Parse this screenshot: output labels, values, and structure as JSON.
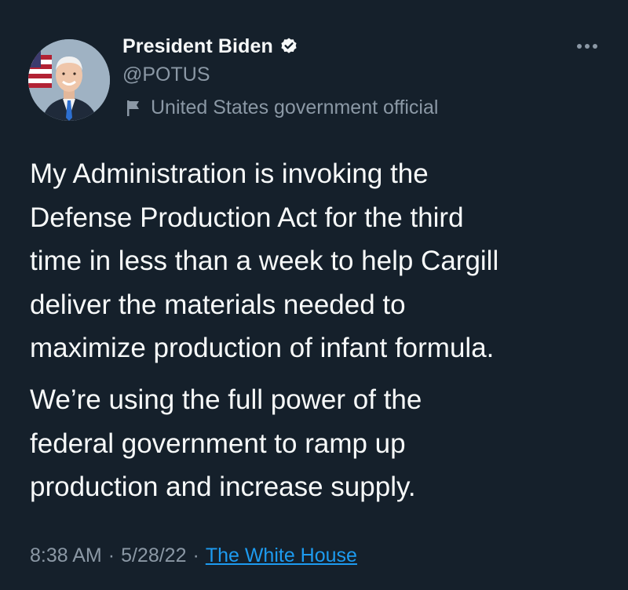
{
  "author": {
    "display_name": "President Biden",
    "handle": "@POTUS",
    "label": "United States government official",
    "verified": true
  },
  "tweet": {
    "paragraphs": [
      "My Administration is invoking the\nDefense Production Act for the third\ntime in less than a week to help Cargill\ndeliver the materials needed to\nmaximize production of infant formula.",
      "We’re using the full power of the\nfederal government to ramp up\nproduction and increase supply."
    ],
    "time": "8:38 AM",
    "date": "5/28/22",
    "separator": "·",
    "source": "The White House"
  },
  "icons": {
    "verified": "verified-badge-icon",
    "label": "flag-icon",
    "more": "more-dots-icon"
  },
  "colors": {
    "background": "#15202b",
    "text_primary": "#f7f9f9",
    "text_secondary": "#8b98a5",
    "link": "#1d9bf0"
  }
}
